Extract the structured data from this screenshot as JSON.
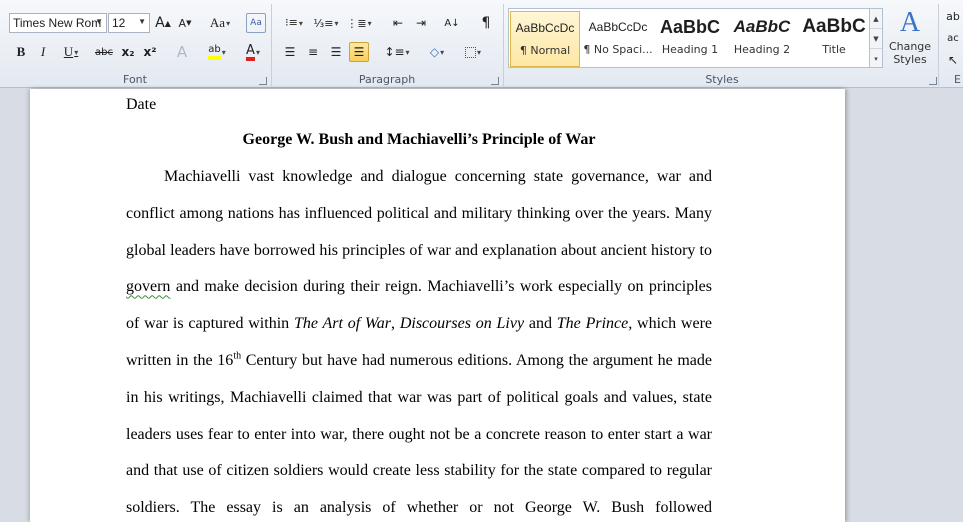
{
  "font_group": {
    "label": "Font",
    "font_name": "Times New Rom",
    "font_size": "12",
    "grow_label": "A",
    "shrink_label": "A",
    "case_label": "Aa",
    "bold_label": "B",
    "italic_label": "I",
    "underline_label": "U",
    "strike_label": "abc",
    "subscript_label": "x₂",
    "superscript_label": "x²",
    "highlight_label": "ab",
    "fontcolor_label": "A",
    "highlight_color": "#ffff00",
    "font_color": "#e02020"
  },
  "paragraph_group": {
    "label": "Paragraph",
    "pilcrow": "¶"
  },
  "styles_group": {
    "label": "Styles",
    "tiles": [
      {
        "sample": "AaBbCcDc",
        "name": "¶ Normal"
      },
      {
        "sample": "AaBbCcDc",
        "name": "¶ No Spaci..."
      },
      {
        "sample": "AaBbC",
        "name": "Heading 1"
      },
      {
        "sample": "AaBbC",
        "name": "Heading 2"
      },
      {
        "sample": "AaBbC",
        "name": "Title"
      }
    ],
    "change_styles_label": "Change Styles",
    "accent": "#3b73c6"
  },
  "edit_group": {
    "label": "E"
  },
  "document": {
    "date_line": "Date",
    "title": "George W. Bush and Machiavelli’s Principle of War",
    "lines": {
      "l1": "Machiavelli vast knowledge and dialogue concerning state governance, war and",
      "l2": "conflict among nations has influenced political and military thinking over the years. Many",
      "l3": "global leaders have borrowed his principles of war and explanation about ancient history to",
      "l4_word": "govern",
      "l4_rest": " and make decision during their reign. Machiavelli’s work especially on principles",
      "l5_a": "of war is captured within ",
      "l5_i1": "The Art of War",
      "l5_b": ", ",
      "l5_i2": "Discourses on Livy",
      "l5_c": " and ",
      "l5_i3": "The Prince,",
      "l5_d": " which were",
      "l6_a": "written in the 16",
      "l6_sup": "th",
      "l6_b": " Century but have had numerous editions. Among the argument he made",
      "l7": "in his writings, Machiavelli claimed that war was part of political goals and values, state",
      "l8": "leaders uses fear to enter into war, there ought not be a concrete reason to enter start a war",
      "l9": "and that use of citizen soldiers would create less stability for the state compared to regular",
      "l10": "soldiers. The essay is an analysis of whether or not George W. Bush followed"
    }
  }
}
